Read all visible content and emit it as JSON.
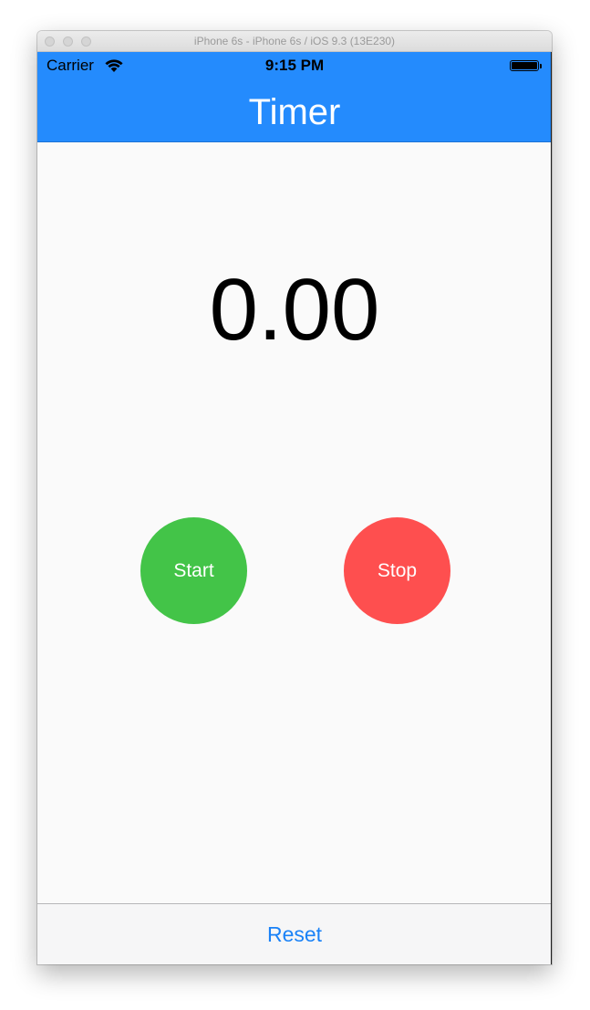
{
  "window": {
    "title": "iPhone 6s - iPhone 6s / iOS 9.3 (13E230)"
  },
  "status_bar": {
    "carrier": "Carrier",
    "time": "9:15 PM",
    "icons": [
      "wifi-icon",
      "battery-icon"
    ],
    "battery_level": 1.0
  },
  "nav": {
    "title": "Timer",
    "background_color": "#248bfd"
  },
  "timer": {
    "display": "0.00"
  },
  "buttons": {
    "start_label": "Start",
    "start_color": "#43c448",
    "stop_label": "Stop",
    "stop_color": "#fe4f4f"
  },
  "toolbar": {
    "reset_label": "Reset",
    "reset_color": "#1a82f7"
  }
}
